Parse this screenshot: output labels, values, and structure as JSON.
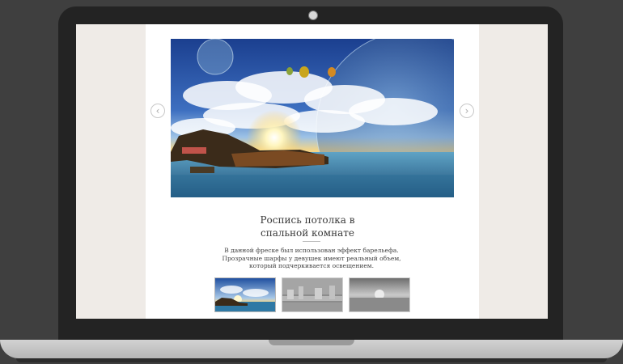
{
  "slider": {
    "prev_arrow": "‹",
    "next_arrow": "›",
    "active_index": 0,
    "thumbnail_count": 3
  },
  "article": {
    "title": "Роспись потолка в спальной комнате",
    "description_lines": [
      "В данной фреске был использован эффект барельефа.",
      "Прозрачные шарфы у девушек имеют реальный объем,",
      "который подчеркивается освещением."
    ]
  },
  "colors": {
    "screen_background": "#efebe7",
    "page_background": "#ffffff",
    "laptop_body": "#232323",
    "title_text": "#3a3a3a"
  }
}
